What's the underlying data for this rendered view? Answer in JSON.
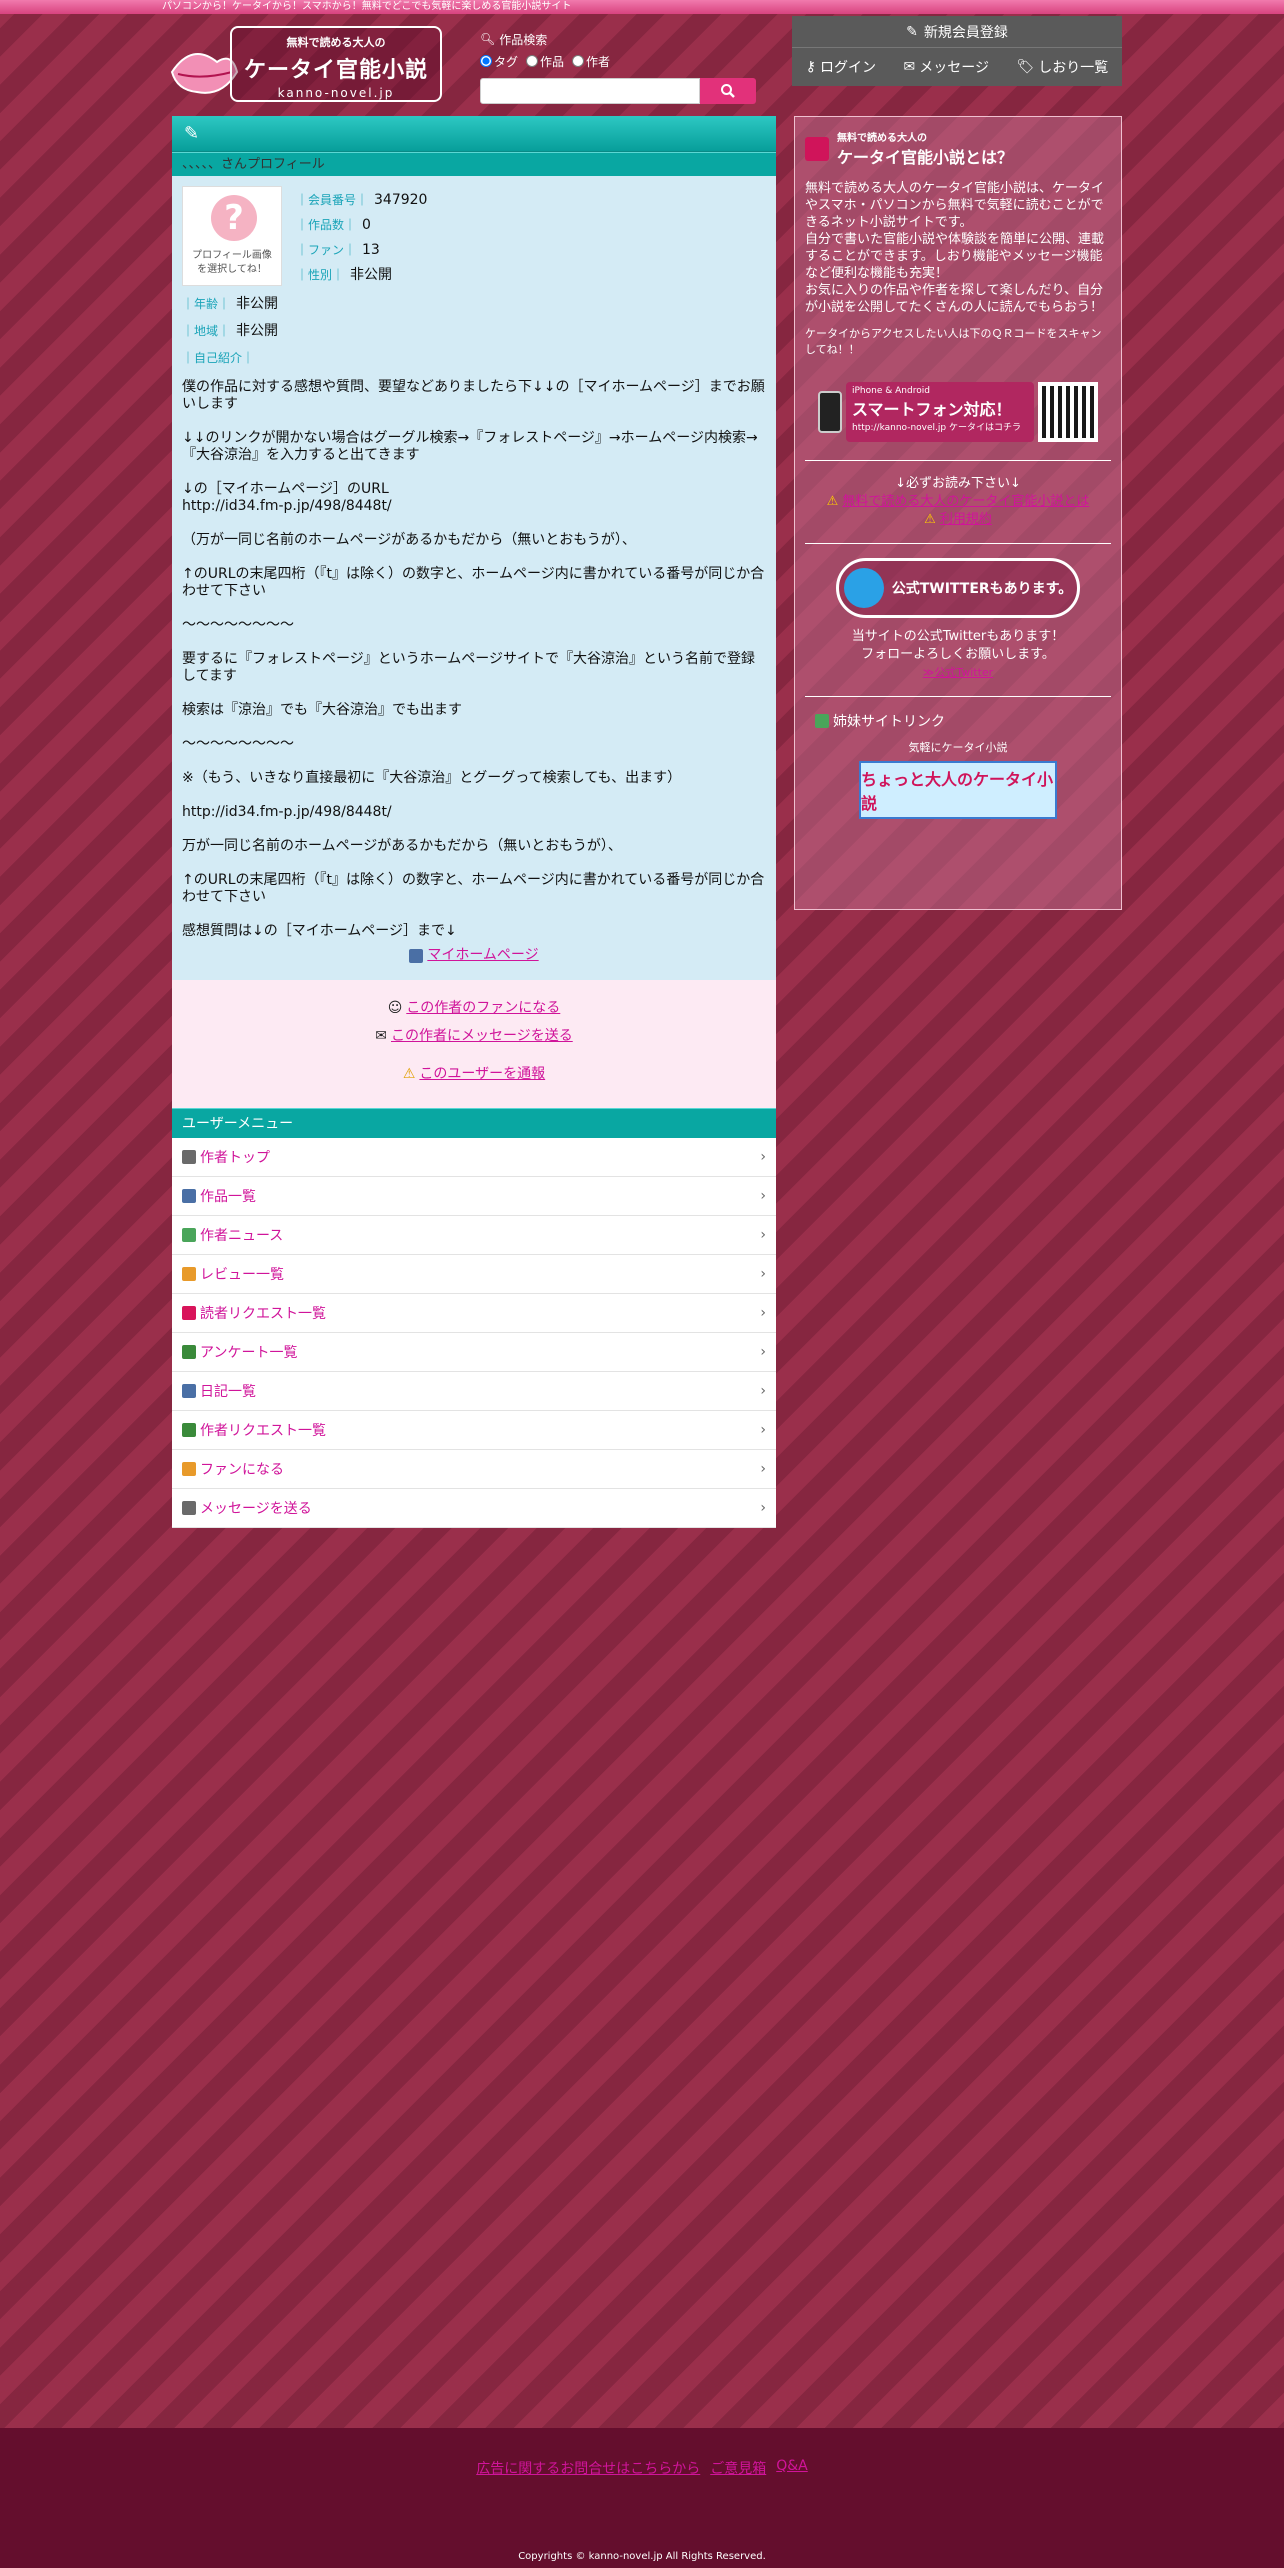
{
  "topbar": "パソコンから！ケータイから！スマホから！無料でどこでも気軽に楽しめる官能小説サイト",
  "logo": {
    "line1": "無料で読める大人の",
    "line2": "ケータイ官能小説",
    "line3": "kanno-novel.jp"
  },
  "search": {
    "label": "作品検索",
    "options": [
      "タグ",
      "作品",
      "作者"
    ],
    "placeholder": ""
  },
  "member": {
    "register": "新規会員登録",
    "login": "ログイン",
    "message": "メッセージ",
    "bookmarks": "しおり一覧"
  },
  "profile": {
    "heading": "、、、、、さんプロフィール",
    "avatar_caption1": "プロフィール画像",
    "avatar_caption2": "を選択してね！",
    "member_no_label": "｜会員番号｜",
    "member_no": "347920",
    "works_label": "｜作品数｜",
    "works": "0",
    "fans_label": "｜ファン｜",
    "fans": "13",
    "gender_label": "｜性別｜",
    "gender": "非公開",
    "age_label": "｜年齢｜",
    "age": "非公開",
    "region_label": "｜地域｜",
    "region": "非公開",
    "intro_label": "｜自己紹介｜",
    "bio": [
      "僕の作品に対する感想や質問、要望などありましたら下↓↓の［マイホームページ］までお願いします",
      "↓↓のリンクが開かない場合はグーグル検索→『フォレストページ』→ホームページ内検索→『大谷涼治』を入力すると出てきます",
      "↓の［マイホームページ］のURL\nhttp://id34.fm-p.jp/498/8448t/",
      "（万が一同じ名前のホームページがあるかもだから（無いとおもうが）、",
      "↑のURLの末尾四桁（『t』は除く）の数字と、ホームページ内に書かれている番号が同じか合わせて下さい",
      "〜〜〜〜〜〜〜〜",
      "要するに『フォレストページ』というホームページサイトで『大谷涼治』という名前で登録してます",
      "検索は『涼治』でも『大谷涼治』でも出ます",
      "〜〜〜〜〜〜〜〜",
      "",
      "※（もう、いきなり直接最初に『大谷涼治』とグーグって検索しても、出ます）",
      "http://id34.fm-p.jp/498/8448t/",
      "万が一同じ名前のホームページがあるかもだから（無いとおもうが）、",
      "↑のURLの末尾四桁（『t』は除く）の数字と、ホームページ内に書かれている番号が同じか合わせて下さい",
      "",
      "",
      "感想質問は↓の［マイホームページ］まで↓"
    ],
    "homepage_link": "マイホームページ"
  },
  "actions": {
    "become_fan": "この作者のファンになる",
    "send_message": "この作者にメッセージを送る",
    "report": "このユーザーを通報"
  },
  "user_menu": {
    "heading": "ユーザーメニュー",
    "items": [
      {
        "label": "作者トップ",
        "icon": "home-icon",
        "color": "#6a6a6a"
      },
      {
        "label": "作品一覧",
        "icon": "book-icon",
        "color": "#4a6fa5"
      },
      {
        "label": "作者ニュース",
        "icon": "news-icon",
        "color": "#4aa55a"
      },
      {
        "label": "レビュー一覧",
        "icon": "review-icon",
        "color": "#e89a2a"
      },
      {
        "label": "読者リクエスト一覧",
        "icon": "heart-icon",
        "color": "#d8145a"
      },
      {
        "label": "アンケート一覧",
        "icon": "survey-icon",
        "color": "#3a8a3a"
      },
      {
        "label": "日記一覧",
        "icon": "diary-icon",
        "color": "#4a6fa5"
      },
      {
        "label": "作者リクエスト一覧",
        "icon": "request-icon",
        "color": "#3a8a3a"
      },
      {
        "label": "ファンになる",
        "icon": "fan-icon",
        "color": "#e89a2a"
      },
      {
        "label": "メッセージを送る",
        "icon": "mail-icon",
        "color": "#6a6a6a"
      }
    ]
  },
  "sidebar": {
    "title_small": "無料で読める大人の",
    "title_big": "ケータイ官能小説とは？",
    "desc": "無料で読める大人のケータイ官能小説は、ケータイやスマホ・パソコンから無料で気軽に読むことができるネット小説サイトです。\n自分で書いた官能小説や体験談を簡単に公開、連載することができます。しおり機能やメッセージ機能など便利な機能も充実！\nお気に入りの作品や作者を探して楽しんだり、自分が小説を公開してたくさんの人に読んでもらおう！",
    "qr_note": "ケータイからアクセスしたい人は下のＱＲコードをスキャンしてね！！",
    "sp_line1": "iPhone & Android",
    "sp_line2": "スマートフォン対応！",
    "sp_line3": "http://kanno-novel.jp",
    "sp_line4": "ケータイはコチラ",
    "must_read": "↓必ずお読み下さい↓",
    "warning_link": "利用規約",
    "warning_link_long": "無料で読める大人のケータイ官能小説とは",
    "twitter_banner": "公式TWITTERもあります。",
    "twitter_line1": "当サイトの公式Twitterもあります！",
    "twitter_line2": "フォローよろしくお願いします。",
    "twitter_link": "≫公式Twitter",
    "sister_title": "姉妹サイトリンク",
    "sister_sub": "気軽にケータイ小説",
    "sister_banner": "ちょっと大人のケータイ小説"
  },
  "footer": {
    "ad_contact": "広告に関するお問合せはこちらから",
    "feedback": "ご意見箱",
    "faq": "Q&A",
    "copyright": "Copyrights © kanno-novel.jp All Rights Reserved."
  }
}
